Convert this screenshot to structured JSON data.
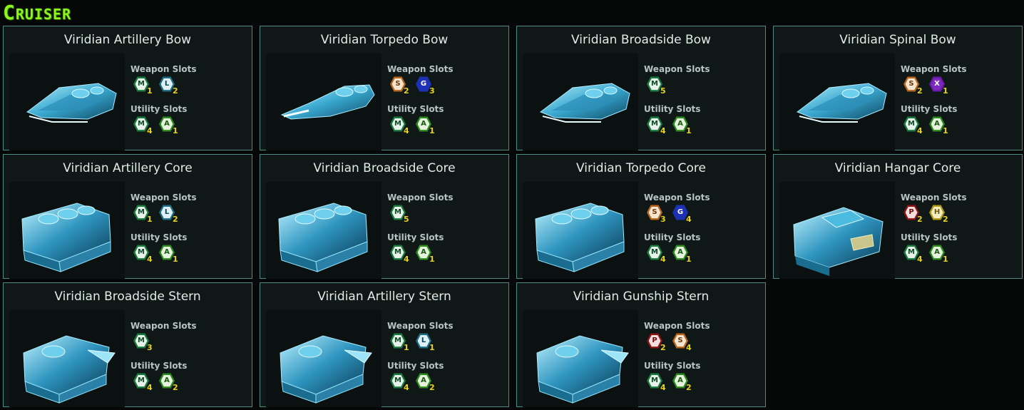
{
  "page": {
    "title": "Cruiser"
  },
  "labels": {
    "weapon_slots": "Weapon Slots",
    "utility_slots": "Utility Slots"
  },
  "slot_types": {
    "M": {
      "outer": "#1b7a3e",
      "inner": "#e6f2ea",
      "text": "#0f4a24"
    },
    "L": {
      "outer": "#1d6e84",
      "inner": "#dff0f5",
      "text": "#0e4656"
    },
    "S": {
      "outer": "#b8651a",
      "inner": "#f4e4d0",
      "text": "#6b3608"
    },
    "G": {
      "outer": "#1b33b0",
      "inner": "#1e2fb8",
      "text": "#ffffff"
    },
    "X": {
      "outer": "#6a1aa6",
      "inner": "#7e2ac0",
      "text": "#ffffff"
    },
    "P": {
      "outer": "#8e1414",
      "inner": "#f5dede",
      "text": "#6b0b0b"
    },
    "H": {
      "outer": "#b09a12",
      "inner": "#f3ecc4",
      "text": "#6b5b06"
    },
    "A": {
      "outer": "#2c8a1c",
      "inner": "#e4f2de",
      "text": "#1d5a10"
    }
  },
  "modules": [
    {
      "name": "Viridian Artillery Bow",
      "ship_icon": "bow-ship-icon",
      "weapon": [
        {
          "type": "M",
          "count": "1"
        },
        {
          "type": "L",
          "count": "2"
        }
      ],
      "utility": [
        {
          "type": "M",
          "count": "4"
        },
        {
          "type": "A",
          "count": "1"
        }
      ]
    },
    {
      "name": "Viridian Torpedo Bow",
      "ship_icon": "torpedo-bow-ship-icon",
      "weapon": [
        {
          "type": "S",
          "count": "2"
        },
        {
          "type": "G",
          "count": "3"
        }
      ],
      "utility": [
        {
          "type": "M",
          "count": "4"
        },
        {
          "type": "A",
          "count": "1"
        }
      ]
    },
    {
      "name": "Viridian Broadside Bow",
      "ship_icon": "bow-ship-icon",
      "weapon": [
        {
          "type": "M",
          "count": "5"
        }
      ],
      "utility": [
        {
          "type": "M",
          "count": "4"
        },
        {
          "type": "A",
          "count": "1"
        }
      ]
    },
    {
      "name": "Viridian Spinal Bow",
      "ship_icon": "bow-ship-icon",
      "weapon": [
        {
          "type": "S",
          "count": "2"
        },
        {
          "type": "X",
          "count": "1"
        }
      ],
      "utility": [
        {
          "type": "M",
          "count": "4"
        },
        {
          "type": "A",
          "count": "1"
        }
      ]
    },
    {
      "name": "Viridian Artillery Core",
      "ship_icon": "core-ship-icon",
      "weapon": [
        {
          "type": "M",
          "count": "1"
        },
        {
          "type": "L",
          "count": "2"
        }
      ],
      "utility": [
        {
          "type": "M",
          "count": "4"
        },
        {
          "type": "A",
          "count": "1"
        }
      ]
    },
    {
      "name": "Viridian Broadside Core",
      "ship_icon": "core-ship-icon",
      "weapon": [
        {
          "type": "M",
          "count": "5"
        }
      ],
      "utility": [
        {
          "type": "M",
          "count": "4"
        },
        {
          "type": "A",
          "count": "1"
        }
      ]
    },
    {
      "name": "Viridian Torpedo Core",
      "ship_icon": "core-ship-icon",
      "weapon": [
        {
          "type": "S",
          "count": "3"
        },
        {
          "type": "G",
          "count": "4"
        }
      ],
      "utility": [
        {
          "type": "M",
          "count": "4"
        },
        {
          "type": "A",
          "count": "1"
        }
      ]
    },
    {
      "name": "Viridian Hangar Core",
      "ship_icon": "hangar-core-ship-icon",
      "weapon": [
        {
          "type": "P",
          "count": "2"
        },
        {
          "type": "H",
          "count": "2"
        }
      ],
      "utility": [
        {
          "type": "M",
          "count": "4"
        },
        {
          "type": "A",
          "count": "1"
        }
      ]
    },
    {
      "name": "Viridian Broadside Stern",
      "ship_icon": "stern-ship-icon",
      "weapon": [
        {
          "type": "M",
          "count": "3"
        }
      ],
      "utility": [
        {
          "type": "M",
          "count": "4"
        },
        {
          "type": "A",
          "count": "2"
        }
      ]
    },
    {
      "name": "Viridian Artillery Stern",
      "ship_icon": "stern-ship-icon",
      "weapon": [
        {
          "type": "M",
          "count": "1"
        },
        {
          "type": "L",
          "count": "1"
        }
      ],
      "utility": [
        {
          "type": "M",
          "count": "4"
        },
        {
          "type": "A",
          "count": "2"
        }
      ]
    },
    {
      "name": "Viridian Gunship Stern",
      "ship_icon": "stern-ship-icon",
      "weapon": [
        {
          "type": "P",
          "count": "2"
        },
        {
          "type": "S",
          "count": "4"
        }
      ],
      "utility": [
        {
          "type": "M",
          "count": "4"
        },
        {
          "type": "A",
          "count": "2"
        }
      ]
    }
  ]
}
